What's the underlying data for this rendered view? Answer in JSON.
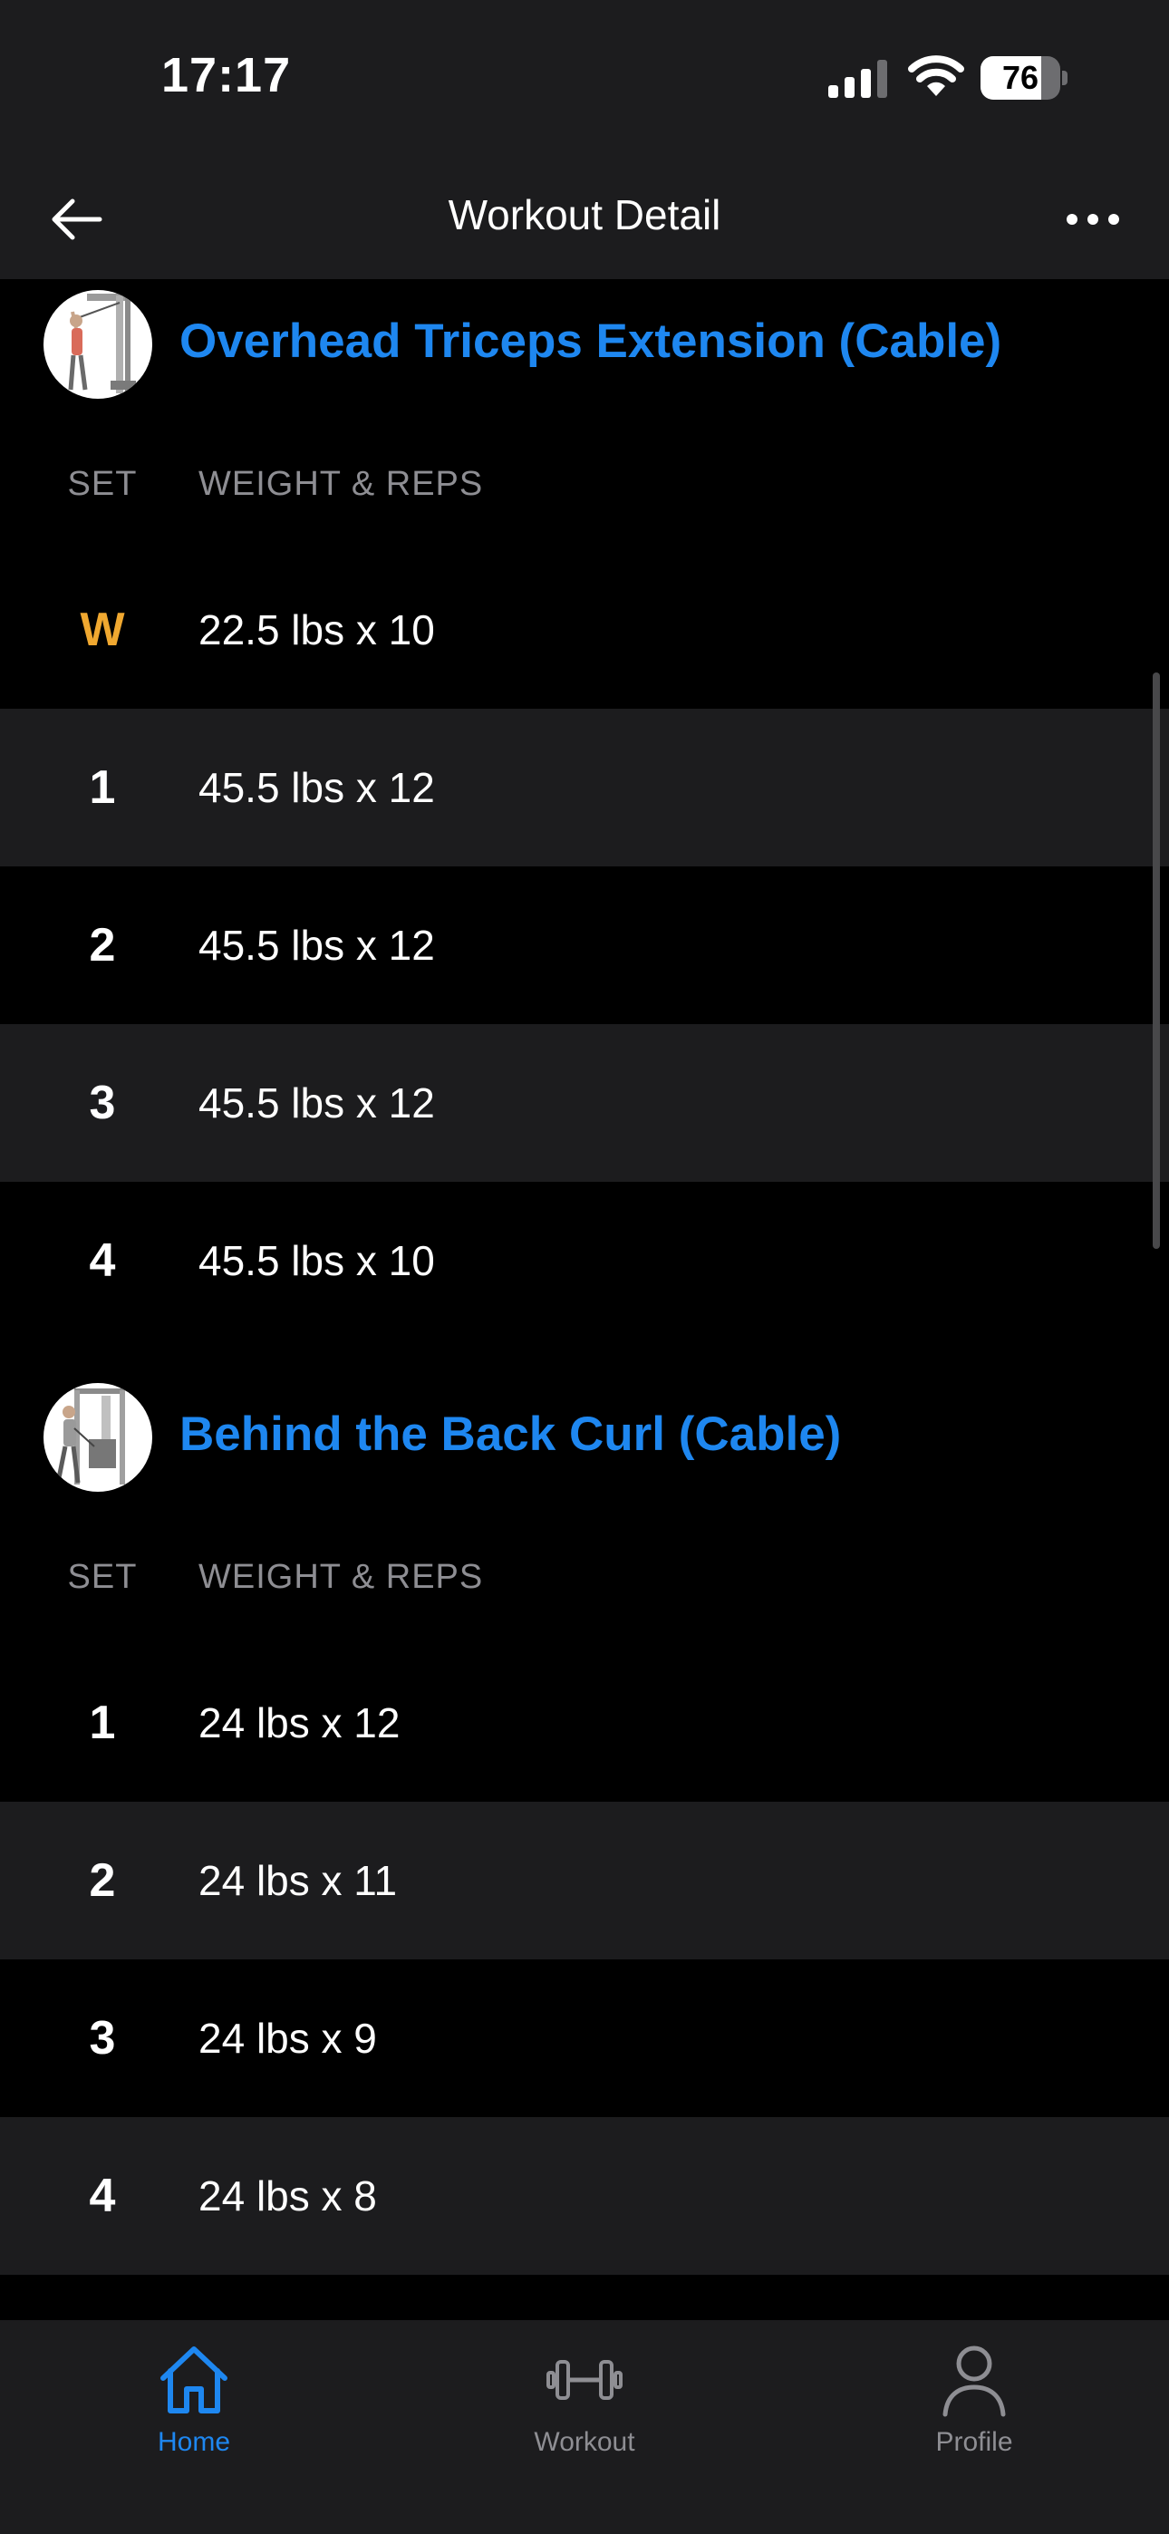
{
  "status_bar": {
    "time": "17:17",
    "battery": "76",
    "battery_fraction": 0.76
  },
  "header": {
    "title": "Workout Detail"
  },
  "columns": {
    "set": "SET",
    "weight_reps": "WEIGHT & REPS"
  },
  "exercises": [
    {
      "name": "Overhead Triceps Extension (Cable)",
      "thumbnail_icon": "cable-triceps-extension-illustration",
      "sets": [
        {
          "set": "W",
          "value": "22.5 lbs x 10"
        },
        {
          "set": "1",
          "value": "45.5 lbs x 12"
        },
        {
          "set": "2",
          "value": "45.5 lbs x 12"
        },
        {
          "set": "3",
          "value": "45.5 lbs x 12"
        },
        {
          "set": "4",
          "value": "45.5 lbs x 10"
        }
      ]
    },
    {
      "name": "Behind the Back Curl (Cable)",
      "thumbnail_icon": "cable-curl-illustration",
      "sets": [
        {
          "set": "1",
          "value": "24 lbs x 12"
        },
        {
          "set": "2",
          "value": "24 lbs x 11"
        },
        {
          "set": "3",
          "value": "24 lbs x 9"
        },
        {
          "set": "4",
          "value": "24 lbs x 8"
        }
      ]
    }
  ],
  "tabs": [
    {
      "label": "Home",
      "icon": "home-icon",
      "active": true
    },
    {
      "label": "Workout",
      "icon": "dumbbell-icon",
      "active": false
    },
    {
      "label": "Profile",
      "icon": "profile-icon",
      "active": false
    }
  ],
  "colors": {
    "accent": "#1e87f0",
    "warmup": "#f0a830",
    "background": "#000000",
    "surface": "#1c1c1e",
    "muted": "#8e8e93"
  }
}
